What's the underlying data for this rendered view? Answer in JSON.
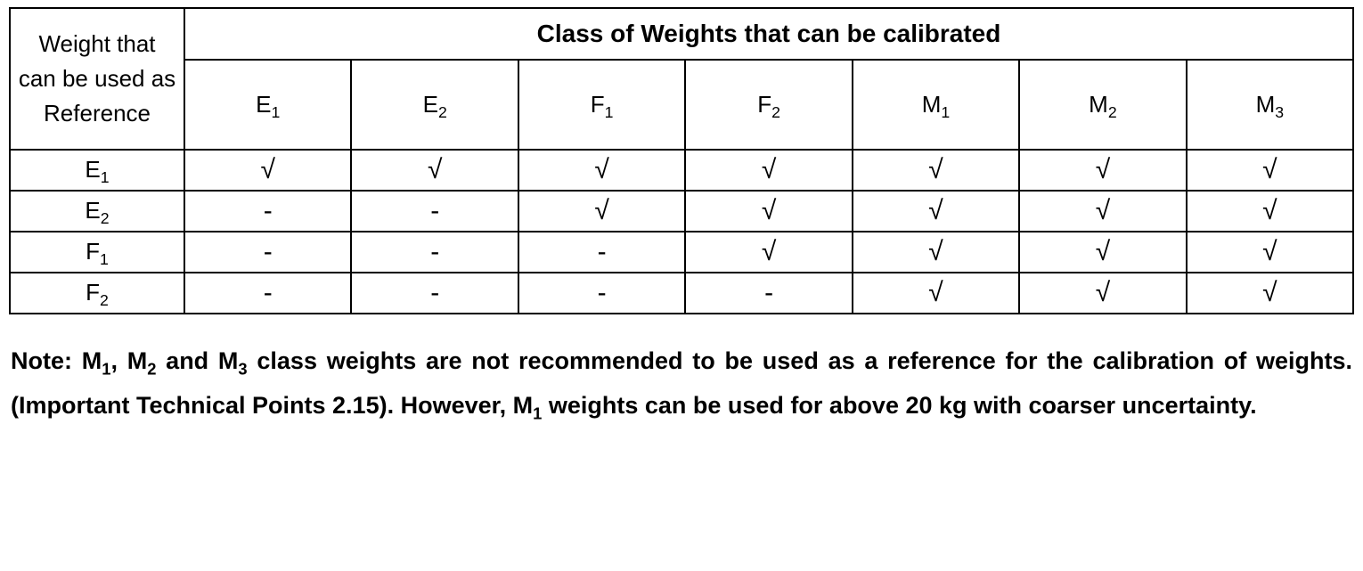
{
  "chart_data": {
    "type": "table",
    "row_header_title": "Weight that can be used as Reference",
    "column_header_title": "Class of Weights that can be calibrated",
    "columns": [
      "E1",
      "E2",
      "F1",
      "F2",
      "M1",
      "M2",
      "M3"
    ],
    "rows": [
      {
        "label": "E1",
        "values": [
          "√",
          "√",
          "√",
          "√",
          "√",
          "√",
          "√"
        ]
      },
      {
        "label": "E2",
        "values": [
          "-",
          "-",
          "√",
          "√",
          "√",
          "√",
          "√"
        ]
      },
      {
        "label": "F1",
        "values": [
          "-",
          "-",
          "-",
          "√",
          "√",
          "√",
          "√"
        ]
      },
      {
        "label": "F2",
        "values": [
          "-",
          "-",
          "-",
          "-",
          "√",
          "√",
          "√"
        ]
      }
    ]
  },
  "labels_html": {
    "E1": "E<sub>1</sub>",
    "E2": "E<sub>2</sub>",
    "F1": "F<sub>1</sub>",
    "F2": "F<sub>2</sub>",
    "M1": "M<sub>1</sub>",
    "M2": "M<sub>2</sub>",
    "M3": "M<sub>3</sub>"
  },
  "note_html": "Note: M<sub>1</sub>, M<sub>2</sub> and M<sub>3</sub> class weights are not recommended to be used as a reference for the calibration of weights. (Important Technical Points 2.15). However, M<sub>1</sub> weights can be used for above 20 kg with coarser uncertainty."
}
